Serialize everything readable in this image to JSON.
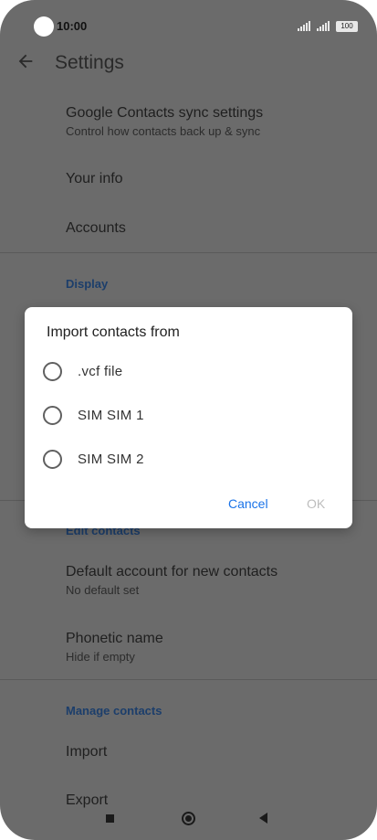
{
  "status_bar": {
    "time": "10:00",
    "battery": "100"
  },
  "header": {
    "title": "Settings"
  },
  "settings": {
    "google_sync": {
      "title": "Google Contacts sync settings",
      "subtitle": "Control how contacts back up & sync"
    },
    "your_info": {
      "title": "Your info"
    },
    "accounts": {
      "title": "Accounts"
    },
    "display_header": "Display",
    "edit_contacts_header": "Edit contacts",
    "default_account": {
      "title": "Default account for new contacts",
      "subtitle": "No default set"
    },
    "phonetic_name": {
      "title": "Phonetic name",
      "subtitle": "Hide if empty"
    },
    "manage_contacts_header": "Manage contacts",
    "import": {
      "title": "Import"
    },
    "export": {
      "title": "Export"
    }
  },
  "dialog": {
    "title": "Import contacts from",
    "options": [
      {
        "label": ".vcf file",
        "selected": false
      },
      {
        "label": "SIM SIM 1",
        "selected": false
      },
      {
        "label": "SIM SIM 2",
        "selected": false
      }
    ],
    "cancel_label": "Cancel",
    "ok_label": "OK"
  },
  "colors": {
    "accent": "#1a73e8",
    "scrim": "#6b6b6b",
    "section": "#1c3e6b"
  }
}
